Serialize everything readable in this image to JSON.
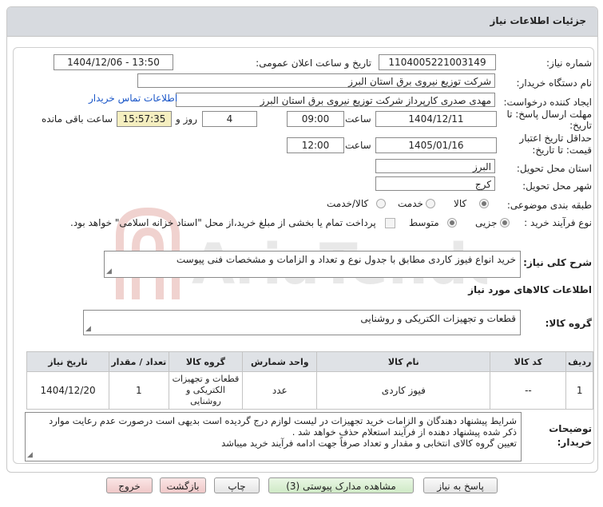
{
  "title": "جزئیات اطلاعات نیاز",
  "need_number": {
    "label": "شماره نیاز:",
    "value": "1104005221003149"
  },
  "announce_datetime": {
    "label": "تاریخ و ساعت اعلان عمومی:",
    "value": "1404/12/06 - 13:50"
  },
  "buyer_org": {
    "label": "نام دستگاه خریدار:",
    "value": "شرکت توزیع نیروی برق استان البرز"
  },
  "requester": {
    "label": "ایجاد کننده درخواست:",
    "value": "مهدی صدری کارپرداز شرکت توزیع نیروی برق استان البرز",
    "contact_link": "اطلاعات تماس خریدار"
  },
  "reply_deadline": {
    "label1": "مهلت ارسال پاسخ: تا",
    "label2": "تاریخ:",
    "date": "1404/12/11",
    "time_label": "ساعت",
    "time": "09:00",
    "days": "4",
    "days_label": "روز و",
    "remaining": "15:57:35",
    "remaining_label": "ساعت باقی مانده"
  },
  "price_validity": {
    "label1": "حداقل تاریخ اعتبار",
    "label2": "قیمت: تا تاریخ:",
    "date": "1405/01/16",
    "time_label": "ساعت",
    "time": "12:00"
  },
  "province": {
    "label": "استان محل تحویل:",
    "value": "البرز"
  },
  "city": {
    "label": "شهر محل تحویل:",
    "value": "کرج"
  },
  "category": {
    "label": "طبقه بندی موضوعی:",
    "options": [
      "کالا",
      "خدمت",
      "کالا/خدمت"
    ],
    "selected": "کالا"
  },
  "process_type": {
    "label": "نوع فرآیند خرید :",
    "options": [
      "جزیی",
      "متوسط"
    ],
    "selected": "جزیی",
    "payment_note": "پرداخت تمام یا بخشی از مبلغ خرید،از محل \"اسناد خزانه اسلامی\" خواهد بود."
  },
  "general_description": {
    "label": "شرح کلی نیاز:",
    "value": "خرید انواع فیوز کاردی مطابق با جدول نوع و تعداد و الزامات و مشخصات فنی پیوست"
  },
  "goods_info_heading": "اطلاعات کالاهای مورد نیاز",
  "goods_group": {
    "label": "گروه کالا:",
    "value": "قطعات و تجهیزات الکتریکی و روشنایی"
  },
  "table": {
    "headers": [
      "ردیف",
      "کد کالا",
      "نام کالا",
      "واحد شمارش",
      "گروه کالا",
      "تعداد / مقدار",
      "تاریخ نیاز"
    ],
    "rows": [
      {
        "row": "1",
        "code": "--",
        "name": "فیوز کاردی",
        "unit": "عدد",
        "group": "قطعات و تجهیزات الکتریکی و روشنایی",
        "qty": "1",
        "date": "1404/12/20"
      }
    ]
  },
  "buyer_notes": {
    "label1": "توضیحات",
    "label2": "خریدار:",
    "lines": [
      "شرایط پیشنهاد دهندگان و الزامات خرید تجهیزات در لیست لوازم درج گردیده است بدیهی است درصورت عدم رعایت موارد",
      "ذکر شده پیشنهاد دهنده از فرآیند استعلام حذف خواهد شد .",
      "تعیین گروه کالای انتخابی و مقدار و تعداد صرفاً جهت ادامه فرآیند خرید میباشد"
    ]
  },
  "buttons": {
    "reply": "پاسخ به نیاز",
    "view_docs": "مشاهده مدارک پیوستی (3)",
    "print": "چاپ",
    "back": "بازگشت",
    "exit": "خروج"
  },
  "watermark": "AriaTender.neT",
  "colors": {
    "title_bg": "#d7dadf",
    "highlight": "#f5efc0",
    "link": "#1a56c8",
    "green_btn": "#cfe9c6",
    "pink_btn": "#efc8c8"
  }
}
